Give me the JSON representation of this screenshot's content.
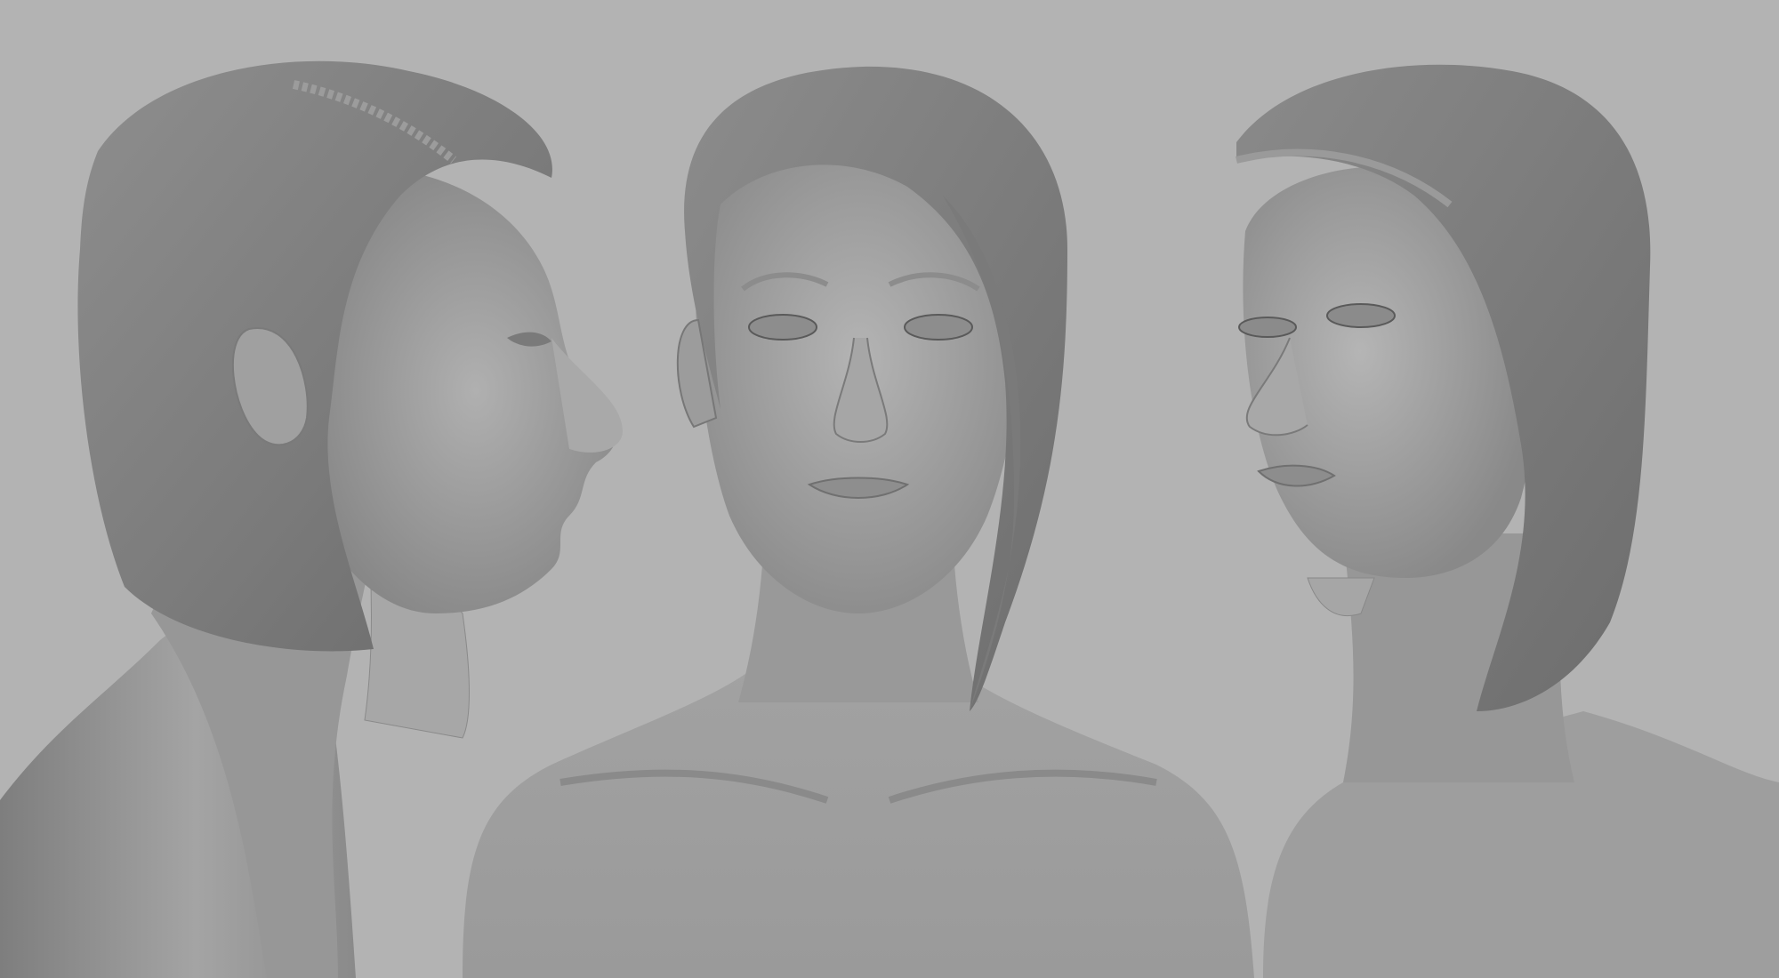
{
  "scene": {
    "background_color": "#b3b3b3",
    "material_color": "#9a9a9a",
    "views": [
      {
        "id": "left-profile",
        "subject": "female-bust-sculpt",
        "facing": "right"
      },
      {
        "id": "front",
        "subject": "female-bust-sculpt",
        "facing": "front"
      },
      {
        "id": "right-three-quarter",
        "subject": "female-bust-sculpt",
        "facing": "left"
      }
    ]
  }
}
